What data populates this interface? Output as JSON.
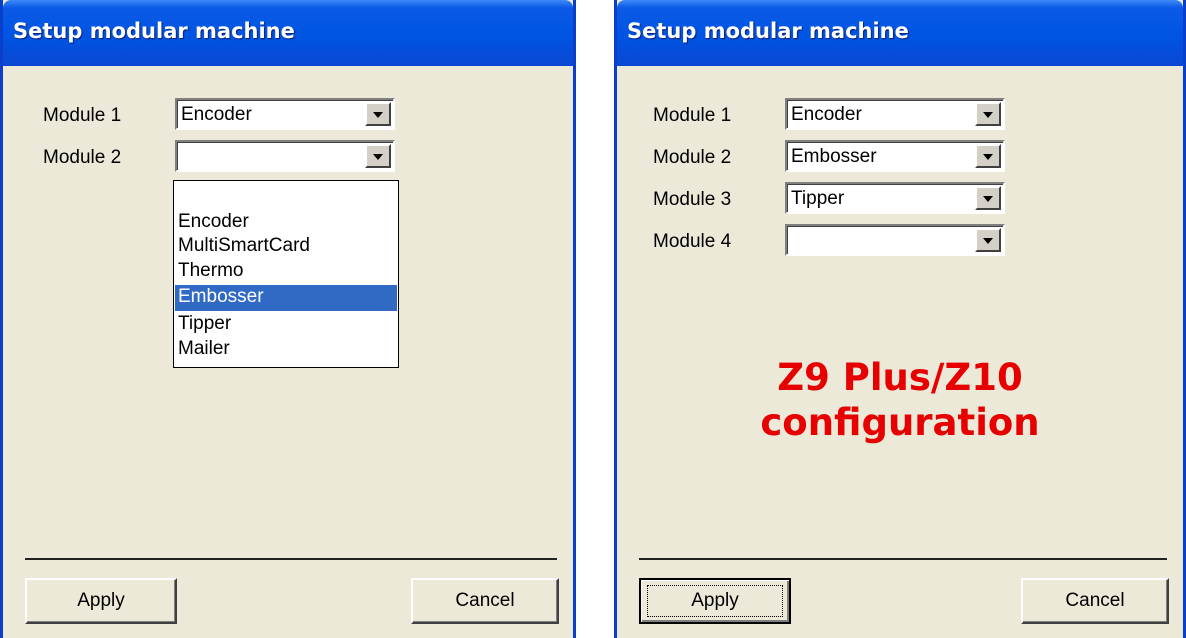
{
  "left_window": {
    "title": "Setup modular machine",
    "modules": [
      {
        "label": "Module 1",
        "value": "Encoder"
      },
      {
        "label": "Module 2",
        "value": ""
      }
    ],
    "dropdown_options": [
      {
        "label": ""
      },
      {
        "label": "Encoder"
      },
      {
        "label": "MultiSmartCard"
      },
      {
        "label": "Thermo"
      },
      {
        "label": "Embosser",
        "selected": true
      },
      {
        "label": "Tipper"
      },
      {
        "label": "Mailer"
      }
    ],
    "apply_label": "Apply",
    "cancel_label": "Cancel"
  },
  "right_window": {
    "title": "Setup modular machine",
    "modules": [
      {
        "label": "Module 1",
        "value": "Encoder"
      },
      {
        "label": "Module 2",
        "value": "Embosser"
      },
      {
        "label": "Module 3",
        "value": "Tipper"
      },
      {
        "label": "Module 4",
        "value": ""
      }
    ],
    "overlay_line1": "Z9 Plus/Z10",
    "overlay_line2": "configuration",
    "apply_label": "Apply",
    "cancel_label": "Cancel"
  },
  "colors": {
    "titlebar": "#0054e3",
    "dialog_background": "#ece9d8",
    "selection_highlight": "#316ac5",
    "overlay_text": "#e60000"
  },
  "icons": {
    "combo_button": "chevron-down-icon"
  }
}
